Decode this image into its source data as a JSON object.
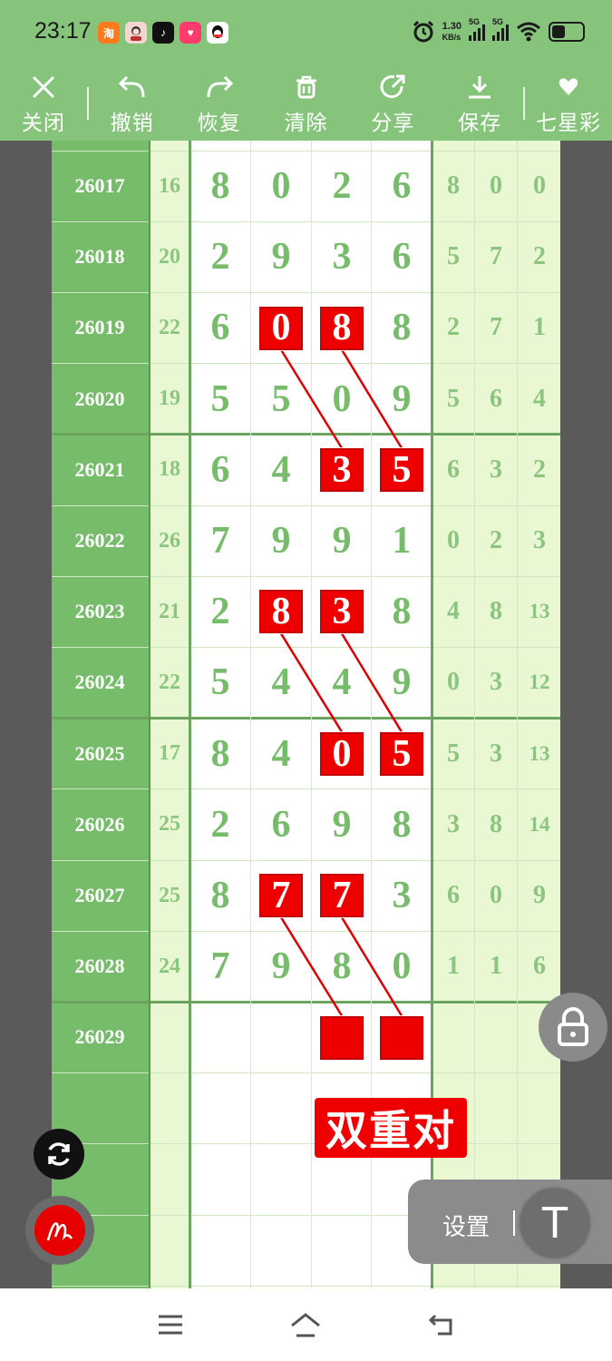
{
  "status_bar": {
    "time": "23:17",
    "net_speed_value": "1.30",
    "net_speed_unit": "KB/s",
    "signal1_label": "5G",
    "signal2_label": "5G",
    "app_icons": [
      "taobao-icon",
      "avatar-app-icon",
      "tiktok-icon",
      "heart-app-icon",
      "qq-icon"
    ]
  },
  "toolbar": {
    "items": [
      {
        "label": "关闭",
        "icon": "close-icon"
      },
      {
        "label": "撤销",
        "icon": "undo-icon"
      },
      {
        "label": "恢复",
        "icon": "redo-icon"
      },
      {
        "label": "清除",
        "icon": "trash-icon"
      },
      {
        "label": "分享",
        "icon": "share-icon"
      },
      {
        "label": "保存",
        "icon": "download-icon"
      },
      {
        "label": "七星彩",
        "icon": "dropdown-heart-icon"
      }
    ]
  },
  "chart": {
    "rows": [
      {
        "issue": "26017",
        "sum": "16",
        "digits": [
          "8",
          "0",
          "2",
          "6"
        ],
        "tail": [
          "8",
          "0",
          "0"
        ]
      },
      {
        "issue": "26018",
        "sum": "20",
        "digits": [
          "2",
          "9",
          "3",
          "6"
        ],
        "tail": [
          "5",
          "7",
          "2"
        ]
      },
      {
        "issue": "26019",
        "sum": "22",
        "digits": [
          "6",
          "0",
          "8",
          "8"
        ],
        "tail": [
          "2",
          "7",
          "1"
        ]
      },
      {
        "issue": "26020",
        "sum": "19",
        "digits": [
          "5",
          "5",
          "0",
          "9"
        ],
        "tail": [
          "5",
          "6",
          "4"
        ]
      },
      {
        "issue": "26021",
        "sum": "18",
        "digits": [
          "6",
          "4",
          "3",
          "5"
        ],
        "tail": [
          "6",
          "3",
          "2"
        ]
      },
      {
        "issue": "26022",
        "sum": "26",
        "digits": [
          "7",
          "9",
          "9",
          "1"
        ],
        "tail": [
          "0",
          "2",
          "3"
        ]
      },
      {
        "issue": "26023",
        "sum": "21",
        "digits": [
          "2",
          "8",
          "3",
          "8"
        ],
        "tail": [
          "4",
          "8",
          "13"
        ]
      },
      {
        "issue": "26024",
        "sum": "22",
        "digits": [
          "5",
          "4",
          "4",
          "9"
        ],
        "tail": [
          "0",
          "3",
          "12"
        ]
      },
      {
        "issue": "26025",
        "sum": "17",
        "digits": [
          "8",
          "4",
          "0",
          "5"
        ],
        "tail": [
          "5",
          "3",
          "13"
        ]
      },
      {
        "issue": "26026",
        "sum": "25",
        "digits": [
          "2",
          "6",
          "9",
          "8"
        ],
        "tail": [
          "3",
          "8",
          "14"
        ]
      },
      {
        "issue": "26027",
        "sum": "25",
        "digits": [
          "8",
          "7",
          "7",
          "3"
        ],
        "tail": [
          "6",
          "0",
          "9"
        ]
      },
      {
        "issue": "26028",
        "sum": "24",
        "digits": [
          "7",
          "9",
          "8",
          "0"
        ],
        "tail": [
          "1",
          "1",
          "6"
        ]
      },
      {
        "issue": "26029",
        "sum": "",
        "digits": [
          "",
          "",
          "",
          ""
        ],
        "tail": [
          "",
          "",
          ""
        ]
      }
    ],
    "highlights": [
      {
        "row": 2,
        "col": 1
      },
      {
        "row": 2,
        "col": 2
      },
      {
        "row": 4,
        "col": 2
      },
      {
        "row": 4,
        "col": 3
      },
      {
        "row": 6,
        "col": 1
      },
      {
        "row": 6,
        "col": 2
      },
      {
        "row": 8,
        "col": 2
      },
      {
        "row": 8,
        "col": 3
      },
      {
        "row": 10,
        "col": 1
      },
      {
        "row": 10,
        "col": 2
      },
      {
        "row": 12,
        "col": 2
      },
      {
        "row": 12,
        "col": 3
      }
    ],
    "connections": [
      {
        "from": [
          2,
          1
        ],
        "to": [
          4,
          2
        ]
      },
      {
        "from": [
          2,
          2
        ],
        "to": [
          4,
          3
        ]
      },
      {
        "from": [
          6,
          1
        ],
        "to": [
          8,
          2
        ]
      },
      {
        "from": [
          6,
          2
        ],
        "to": [
          8,
          3
        ]
      },
      {
        "from": [
          10,
          1
        ],
        "to": [
          12,
          2
        ]
      },
      {
        "from": [
          10,
          2
        ],
        "to": [
          12,
          3
        ]
      }
    ],
    "annotation": "双重对",
    "accent_red": "#ee0000",
    "green_dark": "#77bc6b",
    "green_light": "#e9f7d3"
  },
  "floating": {
    "settings_label": "设置",
    "text_tool_glyph": "T"
  }
}
